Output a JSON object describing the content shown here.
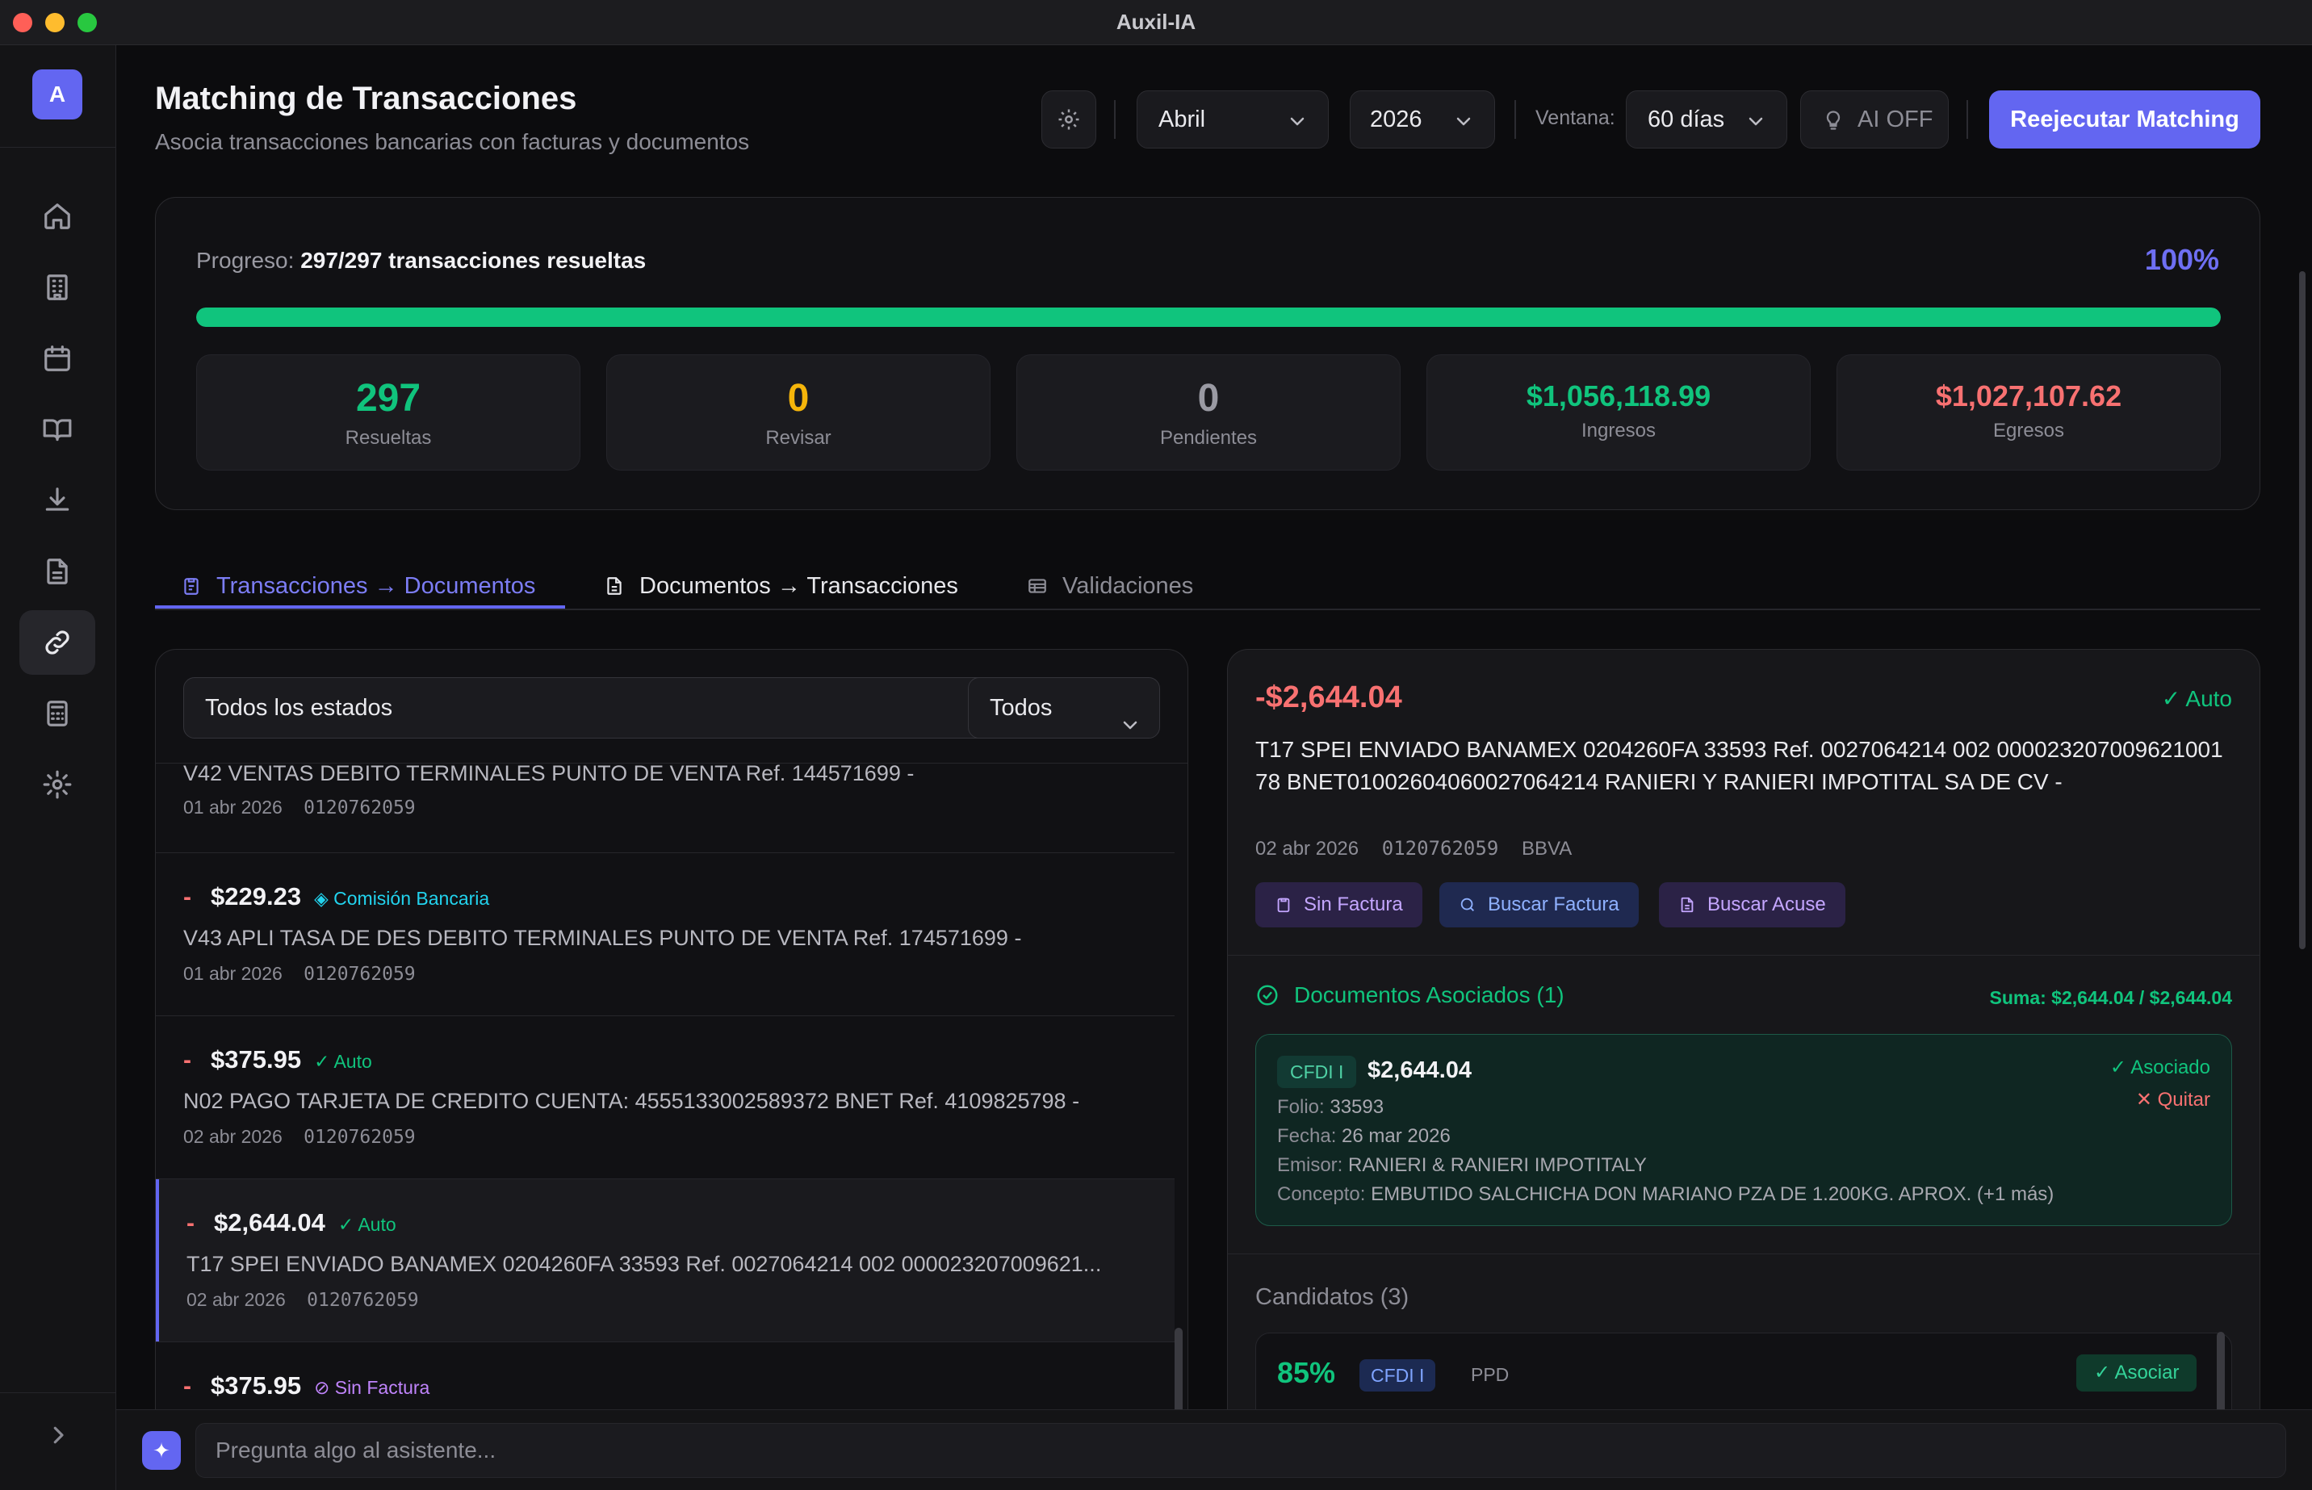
{
  "window": {
    "title": "Auxil-IA"
  },
  "sidebar": {
    "logo": "A",
    "items": [
      {
        "icon": "home-icon"
      },
      {
        "icon": "building-icon"
      },
      {
        "icon": "calendar-icon"
      },
      {
        "icon": "book-icon"
      },
      {
        "icon": "download-icon"
      },
      {
        "icon": "document-icon"
      },
      {
        "icon": "link-icon",
        "active": true
      },
      {
        "icon": "calculator-icon"
      },
      {
        "icon": "gear-icon"
      }
    ],
    "expand_icon": "chevron-right-icon"
  },
  "header": {
    "title": "Matching de Transacciones",
    "subtitle": "Asocia transacciones bancarias con facturas y documentos",
    "month": "Abril",
    "year": "2026",
    "ventana_label": "Ventana:",
    "ventana_value": "60 días",
    "ai_label": "AI OFF",
    "rerun_label": "Reejecutar Matching"
  },
  "progress": {
    "label": "Progreso:",
    "value_text": "297/297 transacciones resueltas",
    "percent_text": "100%",
    "percent": 100,
    "stats": [
      {
        "value": "297",
        "label": "Resueltas",
        "color": "#10c47d"
      },
      {
        "value": "0",
        "label": "Revisar",
        "color": "#f5b50a"
      },
      {
        "value": "0",
        "label": "Pendientes",
        "color": "#9a9aa3"
      },
      {
        "value": "$1,056,118.99",
        "label": "Ingresos",
        "color": "#10c47d"
      },
      {
        "value": "$1,027,107.62",
        "label": "Egresos",
        "color": "#f87171"
      }
    ]
  },
  "tabs": [
    {
      "label": "Transacciones → Documentos",
      "active": true
    },
    {
      "label": "Documentos → Transacciones"
    },
    {
      "label": "Validaciones"
    }
  ],
  "filters": {
    "state": "Todos los estados",
    "type": "Todos"
  },
  "transactions": [
    {
      "desc": "V42 VENTAS DEBITO TERMINALES PUNTO DE VENTA Ref. 144571699 -",
      "date": "01 abr 2026",
      "account": "0120762059"
    },
    {
      "sign": "-",
      "amount": "$229.23",
      "tag": "◈ Comisión Bancaria",
      "tag_color": "#22d3ee",
      "desc": "V43 APLI TASA DE DES DEBITO TERMINALES PUNTO DE VENTA Ref. 174571699 -",
      "date": "01 abr 2026",
      "account": "0120762059"
    },
    {
      "sign": "-",
      "amount": "$375.95",
      "tag": "✓ Auto",
      "tag_color": "#10c47d",
      "desc": "N02 PAGO TARJETA DE CREDITO CUENTA: 4555133002589372 BNET Ref. 4109825798 -",
      "date": "02 abr 2026",
      "account": "0120762059"
    },
    {
      "sign": "-",
      "amount": "$2,644.04",
      "tag": "✓ Auto",
      "tag_color": "#10c47d",
      "desc": "T17 SPEI ENVIADO BANAMEX 0204260FA 33593 Ref. 0027064214 002 000023207009621...",
      "date": "02 abr 2026",
      "account": "0120762059",
      "selected": true
    },
    {
      "sign": "-",
      "amount": "$375.95",
      "tag": "⊘ Sin Factura",
      "tag_color": "#c084fc"
    }
  ],
  "detail": {
    "amount": "-$2,644.04",
    "auto": "✓ Auto",
    "desc": "T17 SPEI ENVIADO BANAMEX 0204260FA 33593 Ref. 0027064214 002 000023207009621001​78 BNET01002604060027064214 RANIERI Y RANIERI IMPOTITAL SA DE CV -",
    "date": "02 abr 2026",
    "account": "0120762059",
    "bank": "BBVA",
    "actions": {
      "sin_factura": "Sin Factura",
      "buscar_factura": "Buscar Factura",
      "buscar_acuse": "Buscar Acuse"
    },
    "associated": {
      "title": "Documentos Asociados (1)",
      "sum": "Suma: $2,644.04 / $2,644.04",
      "doc": {
        "badge": "CFDI I",
        "amount": "$2,644.04",
        "status": "✓ Asociado",
        "remove": "✕ Quitar",
        "folio_label": "Folio:",
        "folio": "33593",
        "fecha_label": "Fecha:",
        "fecha": "26 mar 2026",
        "emisor_label": "Emisor:",
        "emisor": "RANIERI & RANIERI IMPOTITALY",
        "concepto_label": "Concepto:",
        "concepto": "EMBUTIDO SALCHICHA DON MARIANO PZA DE 1.200KG. APROX. (+1 más)"
      }
    },
    "candidates": {
      "title": "Candidatos (3)",
      "first": {
        "pct": "85%",
        "badge": "CFDI I",
        "method": "PPD",
        "action": "✓ Asociar"
      }
    }
  },
  "assistant": {
    "placeholder": "Pregunta algo al asistente..."
  }
}
